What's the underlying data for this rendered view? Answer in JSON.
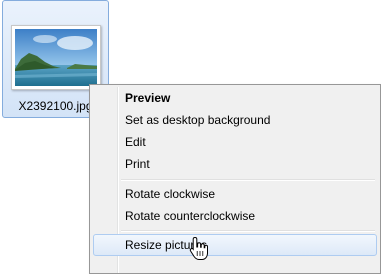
{
  "file": {
    "name": "X2392100.jpg",
    "thumbnail_icon": "landscape-thumbnail-icon"
  },
  "context_menu": {
    "items": [
      {
        "label": "Preview",
        "bold": true
      },
      {
        "label": "Set as desktop background"
      },
      {
        "label": "Edit"
      },
      {
        "label": "Print"
      },
      {
        "label": "Rotate clockwise"
      },
      {
        "label": "Rotate counterclockwise"
      },
      {
        "label": "Resize pictures",
        "highlighted": true
      }
    ]
  },
  "cursor_icon": "hand-pointer-cursor-icon",
  "colors": {
    "selection_border": "#84acdd",
    "selection_fill": "#d3e3f7",
    "menu_background": "#f0f0f0",
    "menu_border": "#979797",
    "hover_border": "#aeccf1",
    "hover_fill": "#dde9f8"
  }
}
